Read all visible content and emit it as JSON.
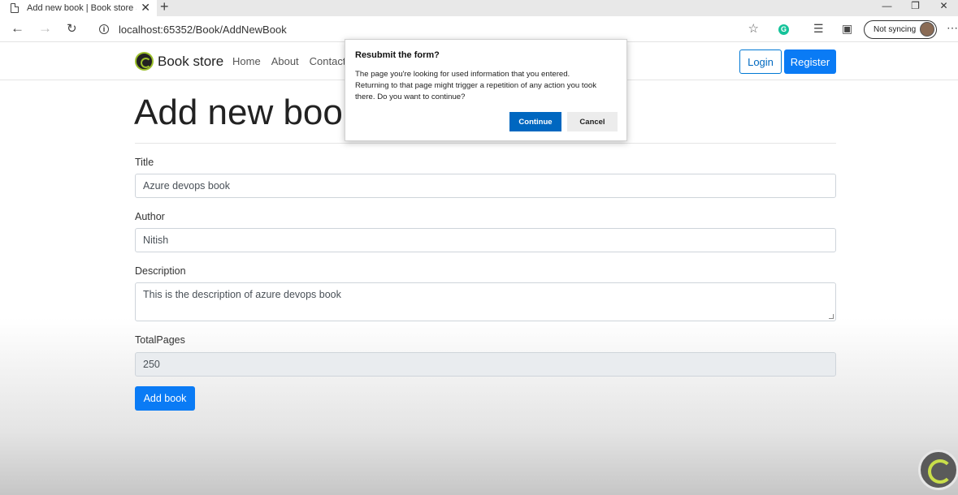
{
  "browser": {
    "tab_title": "Add new book | Book store appl",
    "tab_close": "✕",
    "new_tab": "+",
    "url": "localhost:65352/Book/AddNewBook",
    "profile_label": "Not syncing",
    "controls": {
      "minimize": "—",
      "restore": "❐",
      "close": "✕"
    }
  },
  "site": {
    "brand": "Book store",
    "nav": [
      "Home",
      "About",
      "Contact"
    ],
    "login": "Login",
    "register": "Register"
  },
  "page": {
    "heading": "Add new book",
    "fields": {
      "title": {
        "label": "Title",
        "value": "Azure devops book"
      },
      "author": {
        "label": "Author",
        "value": "Nitish"
      },
      "description": {
        "label": "Description",
        "value": "This is the description of azure devops book"
      },
      "total_pages": {
        "label": "TotalPages",
        "value": "250"
      }
    },
    "submit": "Add book"
  },
  "dialog": {
    "title": "Resubmit the form?",
    "line1": "The page you're looking for used information that you entered.",
    "line2": "Returning to that page might trigger a repetition of any action you took",
    "line3": "there. Do you want to continue?",
    "continue": "Continue",
    "cancel": "Cancel"
  },
  "colors": {
    "primary": "#0a7bf5",
    "dialog_primary": "#0067c0",
    "logo_accent": "#9bbf2a"
  }
}
